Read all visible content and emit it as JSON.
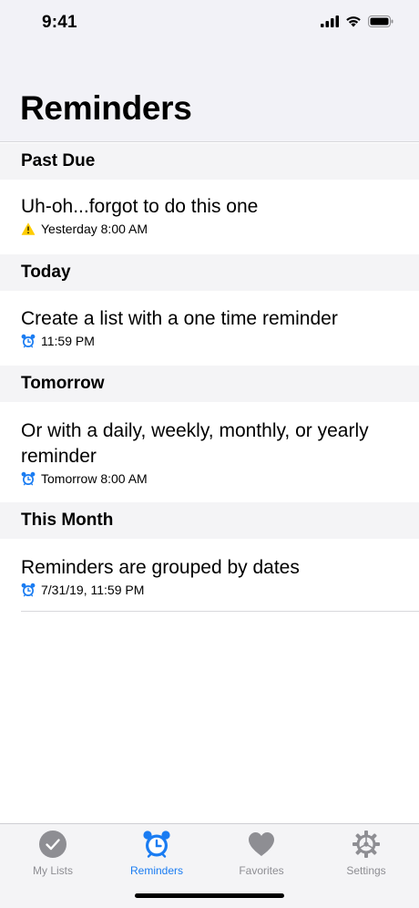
{
  "status_bar": {
    "time": "9:41",
    "icons": [
      "signal-icon",
      "wifi-icon",
      "battery-icon"
    ]
  },
  "header": {
    "title": "Reminders"
  },
  "sections": [
    {
      "title": "Past Due",
      "items": [
        {
          "title": "Uh-oh...forgot to do this one",
          "subtitle": "Yesterday 8:00 AM",
          "icon": "warning-icon"
        }
      ]
    },
    {
      "title": "Today",
      "items": [
        {
          "title": "Create a list with a one time reminder",
          "subtitle": "11:59 PM",
          "icon": "alarm-clock-icon"
        }
      ]
    },
    {
      "title": "Tomorrow",
      "items": [
        {
          "title": "Or with a daily, weekly, monthly, or yearly reminder",
          "subtitle": "Tomorrow 8:00 AM",
          "icon": "alarm-clock-icon"
        }
      ]
    },
    {
      "title": "This Month",
      "items": [
        {
          "title": "Reminders are grouped by dates",
          "subtitle": "7/31/19, 11:59 PM",
          "icon": "alarm-clock-icon"
        }
      ]
    }
  ],
  "tab_bar": {
    "tabs": [
      {
        "label": "My Lists",
        "icon": "checkmark-circle-icon",
        "active": false
      },
      {
        "label": "Reminders",
        "icon": "alarm-clock-icon",
        "active": true
      },
      {
        "label": "Favorites",
        "icon": "heart-icon",
        "active": false
      },
      {
        "label": "Settings",
        "icon": "gear-icon",
        "active": false
      }
    ]
  },
  "colors": {
    "accent": "#1a7cf2",
    "warning": "#ffcc00",
    "inactive": "#8e8e93",
    "section_bg": "#f4f4f6"
  }
}
